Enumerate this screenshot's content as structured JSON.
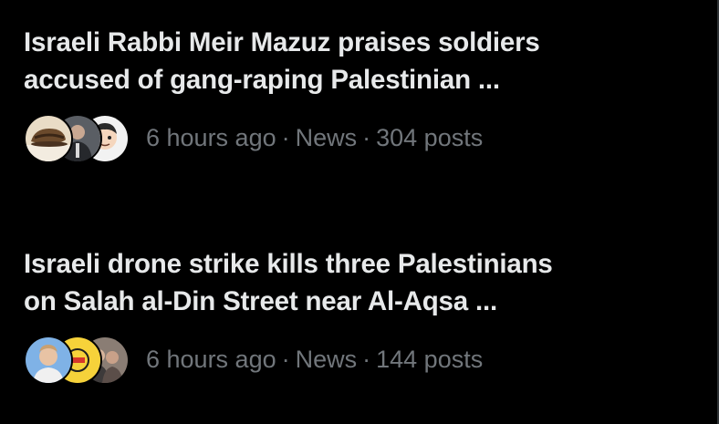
{
  "stories": [
    {
      "headline_line1": "Israeli Rabbi Meir Mazuz praises soldiers",
      "headline_line2": "accused of gang-raping Palestinian ...",
      "time": "6 hours ago",
      "category": "News",
      "posts": "304 posts",
      "avatar_icons": [
        "hat-avatar-icon",
        "man-avatar-icon",
        "cartoon-avatar-icon"
      ]
    },
    {
      "headline_line1": "Israeli drone strike kills three Palestinians",
      "headline_line2": "on Salah al-Din Street near Al-Aqsa ...",
      "time": "6 hours ago",
      "category": "News",
      "posts": "144 posts",
      "avatar_icons": [
        "man-avatar-icon",
        "yellow-logo-avatar-icon",
        "people-avatar-icon"
      ]
    }
  ],
  "separator": "·",
  "colors": {
    "background": "#000000",
    "headline": "#e7e9ea",
    "meta": "#71767b"
  }
}
